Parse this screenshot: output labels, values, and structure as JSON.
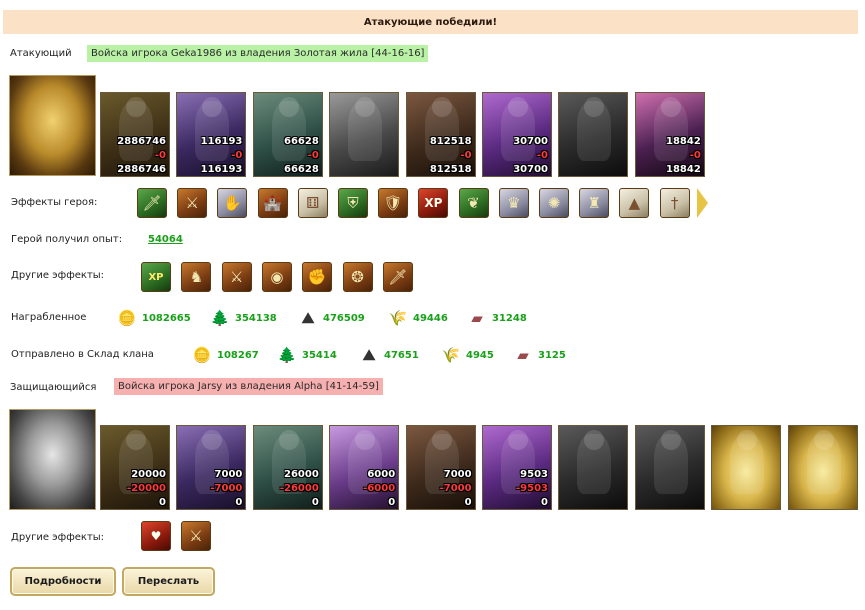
{
  "banner": "Атакующие победили!",
  "attacker": {
    "label": "Атакующий",
    "tag": "Войска игрока Geka1986 из владения Золотая жила [44-16-16]",
    "portrait_icon": "golden-armored-hero-icon",
    "units": [
      {
        "icon": "ogre-unit-icon",
        "n1": "2886746",
        "n2": "-0",
        "n3": "2886746"
      },
      {
        "icon": "swordsman-unit-icon",
        "n1": "116193",
        "n2": "-0",
        "n3": "116193"
      },
      {
        "icon": "dragon-knight-unit-icon",
        "n1": "66628",
        "n2": "-0",
        "n3": "66628"
      },
      {
        "icon": "griffin-unit-icon",
        "n1": "",
        "n2": "",
        "n3": ""
      },
      {
        "icon": "archer-unit-icon",
        "n1": "812518",
        "n2": "-0",
        "n3": "812518"
      },
      {
        "icon": "mage-unit-icon",
        "n1": "30700",
        "n2": "-0",
        "n3": "30700"
      },
      {
        "icon": "hooded-rogue-unit-icon",
        "n1": "",
        "n2": "",
        "n3": ""
      },
      {
        "icon": "dark-knight-unit-icon",
        "n1": "18842",
        "n2": "-0",
        "n3": "18842"
      }
    ]
  },
  "hero_effects": {
    "label": "Эффекты героя:",
    "icons": [
      "sword-buff-icon",
      "crossed-swords-icon",
      "hand-buff-icon",
      "fortress-icon",
      "dice-icon",
      "shield-icon",
      "hand-shield-icon",
      "xp-book-icon",
      "xp-tree-icon",
      "sorceress-icon",
      "web-icon",
      "armor-icon",
      "pyramid-icon",
      "dagger-icon"
    ]
  },
  "hero_xp": {
    "label": "Герой получил опыт:",
    "value": "54064"
  },
  "other_effects_att": {
    "label": "Другие эффекты:",
    "icons": [
      "xp-badge-icon",
      "horse-heart-icon",
      "sword-fist-icon",
      "coins-bag-icon",
      "fist-icon",
      "gold-coins-icon",
      "blue-sword-icon"
    ]
  },
  "loot": {
    "label": "Награбленное",
    "items": [
      {
        "icon": "gold-coin-icon",
        "value": "1082665"
      },
      {
        "icon": "tree-icon",
        "value": "354138"
      },
      {
        "icon": "ore-icon",
        "value": "476509"
      },
      {
        "icon": "wheat-icon",
        "value": "49446"
      },
      {
        "icon": "brick-icon",
        "value": "31248"
      }
    ]
  },
  "clan": {
    "label": "Отправлено в Склад клана",
    "items": [
      {
        "icon": "gold-coin-icon",
        "value": "108267"
      },
      {
        "icon": "tree-icon",
        "value": "35414"
      },
      {
        "icon": "ore-icon",
        "value": "47651"
      },
      {
        "icon": "wheat-icon",
        "value": "4945"
      },
      {
        "icon": "brick-icon",
        "value": "3125"
      }
    ]
  },
  "defender": {
    "label": "Защищающийся",
    "tag": "Войска игрока Jarsy из владения Alpha [41-14-59]",
    "portrait_icon": "silver-winged-hero-icon",
    "units": [
      {
        "icon": "ogre-unit-icon",
        "n1": "20000",
        "n2": "-20000",
        "n3": "0"
      },
      {
        "icon": "swordsman-unit-icon",
        "n1": "7000",
        "n2": "-7000",
        "n3": "0"
      },
      {
        "icon": "dragon-knight-unit-icon",
        "n1": "26000",
        "n2": "-26000",
        "n3": "0"
      },
      {
        "icon": "harpy-unit-icon",
        "n1": "6000",
        "n2": "-6000",
        "n3": "0"
      },
      {
        "icon": "archer-unit-icon",
        "n1": "7000",
        "n2": "-7000",
        "n3": "0"
      },
      {
        "icon": "mage-unit-icon",
        "n1": "9503",
        "n2": "-9503",
        "n3": "0"
      },
      {
        "icon": "hooded-rogue-unit-icon",
        "n1": "",
        "n2": "",
        "n3": ""
      },
      {
        "icon": "spider-knight-unit-icon",
        "n1": "",
        "n2": "",
        "n3": ""
      },
      {
        "icon": "crystal-altar-icon",
        "n1": "",
        "n2": "",
        "n3": ""
      },
      {
        "icon": "crystal-altar-icon",
        "n1": "",
        "n2": "",
        "n3": ""
      }
    ]
  },
  "other_effects_def": {
    "label": "Другие эффекты:",
    "icons": [
      "heart-shield-icon",
      "crossed-swords-icon"
    ]
  },
  "buttons": {
    "details": "Подробности",
    "forward": "Переслать"
  }
}
